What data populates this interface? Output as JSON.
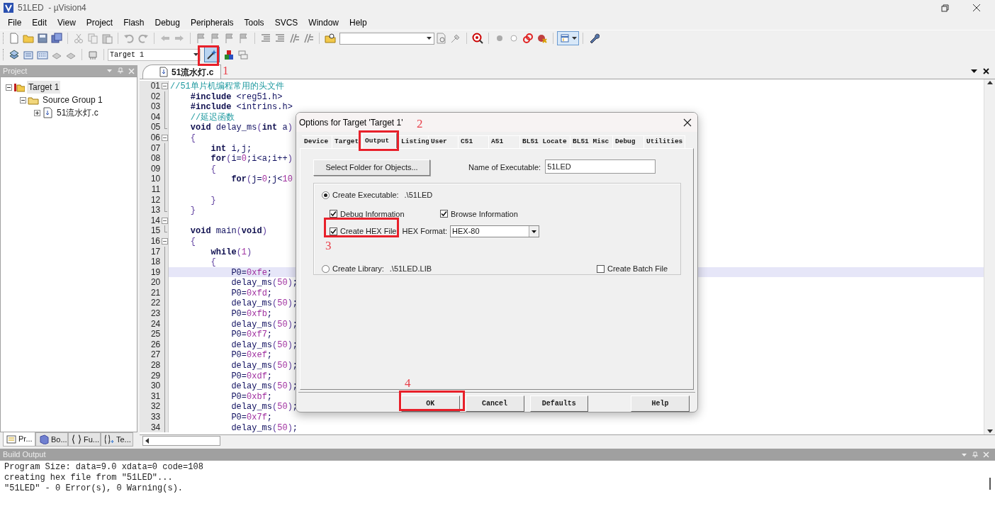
{
  "window": {
    "title": "51LED  - µVision4"
  },
  "menu": [
    "File",
    "Edit",
    "View",
    "Project",
    "Flash",
    "Debug",
    "Peripherals",
    "Tools",
    "SVCS",
    "Window",
    "Help"
  ],
  "build_toolbar": {
    "target": "Target 1"
  },
  "project_panel": {
    "title": "Project",
    "tree": [
      {
        "label": "Target 1",
        "selected": true,
        "expanded": true,
        "children": [
          {
            "label": "Source Group 1",
            "selected": false,
            "expanded": true,
            "children": [
              {
                "label": "51流水灯.c",
                "selected": false,
                "expanded": false
              }
            ]
          }
        ]
      }
    ],
    "tabs": [
      {
        "label": "Pr...",
        "selected": true
      },
      {
        "label": "Bo...",
        "selected": false
      },
      {
        "label": "Fu...",
        "selected": false
      },
      {
        "label": "Te...",
        "selected": false
      }
    ]
  },
  "editor": {
    "tabs": [
      {
        "label": "51流水灯.c",
        "selected": true
      }
    ],
    "lines": [
      {
        "number": "01",
        "kind": "fold_start",
        "current": false,
        "segments": [
          {
            "kind": "comment",
            "text": "//51单片机编程常用的头文件"
          }
        ]
      },
      {
        "number": "02",
        "kind": "fold_body",
        "current": false,
        "segments": [
          {
            "kind": "keyword",
            "text": "    #include"
          },
          {
            "kind": "plain",
            "text": " <reg51.h>"
          }
        ]
      },
      {
        "number": "03",
        "kind": "fold_body",
        "current": false,
        "segments": [
          {
            "kind": "keyword",
            "text": "    #include"
          },
          {
            "kind": "plain",
            "text": " <intrins.h>"
          }
        ]
      },
      {
        "number": "04",
        "kind": "fold_body",
        "current": false,
        "segments": [
          {
            "kind": "comment",
            "text": "    //延迟函数"
          }
        ]
      },
      {
        "number": "05",
        "kind": "fold_end",
        "current": false,
        "segments": [
          {
            "kind": "keyword",
            "text": "    void"
          },
          {
            "kind": "plain",
            "text": " delay_ms"
          },
          {
            "kind": "op",
            "text": "("
          },
          {
            "kind": "keyword",
            "text": "int"
          },
          {
            "kind": "plain",
            "text": " a"
          },
          {
            "kind": "op",
            "text": ")"
          }
        ]
      },
      {
        "number": "06",
        "kind": "fold_start",
        "current": false,
        "segments": [
          {
            "kind": "op",
            "text": "    {"
          }
        ]
      },
      {
        "number": "07",
        "kind": "fold_body",
        "current": false,
        "segments": [
          {
            "kind": "keyword",
            "text": "        int"
          },
          {
            "kind": "plain",
            "text": " i,j;"
          }
        ]
      },
      {
        "number": "08",
        "kind": "fold_body",
        "current": false,
        "segments": [
          {
            "kind": "keyword",
            "text": "        for"
          },
          {
            "kind": "op",
            "text": "("
          },
          {
            "kind": "plain",
            "text": "i="
          },
          {
            "kind": "number",
            "text": "0"
          },
          {
            "kind": "plain",
            "text": ";i<a;i++"
          },
          {
            "kind": "op",
            "text": ")"
          }
        ]
      },
      {
        "number": "09",
        "kind": "fold_body",
        "current": false,
        "segments": [
          {
            "kind": "op",
            "text": "        {"
          }
        ]
      },
      {
        "number": "10",
        "kind": "fold_body",
        "current": false,
        "segments": [
          {
            "kind": "keyword",
            "text": "            for"
          },
          {
            "kind": "op",
            "text": "("
          },
          {
            "kind": "plain",
            "text": "j="
          },
          {
            "kind": "number",
            "text": "0"
          },
          {
            "kind": "plain",
            "text": ";j<"
          },
          {
            "kind": "number",
            "text": "10"
          }
        ]
      },
      {
        "number": "11",
        "kind": "fold_body",
        "current": false
      },
      {
        "number": "12",
        "kind": "fold_body",
        "current": false,
        "segments": [
          {
            "kind": "op",
            "text": "        }"
          }
        ]
      },
      {
        "number": "13",
        "kind": "fold_end",
        "current": false,
        "segments": [
          {
            "kind": "op",
            "text": "    }"
          }
        ]
      },
      {
        "number": "14",
        "kind": "fold_start",
        "current": false
      },
      {
        "number": "15",
        "kind": "fold_end",
        "current": false,
        "segments": [
          {
            "kind": "keyword",
            "text": "    void"
          },
          {
            "kind": "plain",
            "text": " main"
          },
          {
            "kind": "op",
            "text": "("
          },
          {
            "kind": "keyword",
            "text": "void"
          },
          {
            "kind": "op",
            "text": ")"
          }
        ]
      },
      {
        "number": "16",
        "kind": "fold_start",
        "current": false,
        "segments": [
          {
            "kind": "op",
            "text": "    {"
          }
        ]
      },
      {
        "number": "17",
        "kind": "fold_body",
        "current": false,
        "segments": [
          {
            "kind": "keyword",
            "text": "        while"
          },
          {
            "kind": "op",
            "text": "("
          },
          {
            "kind": "number",
            "text": "1"
          },
          {
            "kind": "op",
            "text": ")"
          }
        ]
      },
      {
        "number": "18",
        "kind": "fold_body",
        "current": false,
        "segments": [
          {
            "kind": "op",
            "text": "        {"
          }
        ]
      },
      {
        "number": "19",
        "kind": "fold_body",
        "current": true,
        "segments": [
          {
            "kind": "plain",
            "text": "            P0="
          },
          {
            "kind": "number",
            "text": "0xfe"
          },
          {
            "kind": "plain",
            "text": ";"
          }
        ]
      },
      {
        "number": "20",
        "kind": "fold_body",
        "current": false,
        "segments": [
          {
            "kind": "plain",
            "text": "            delay_ms"
          },
          {
            "kind": "op",
            "text": "("
          },
          {
            "kind": "number",
            "text": "50"
          },
          {
            "kind": "op",
            "text": ")"
          },
          {
            "kind": "plain",
            "text": ";"
          }
        ]
      },
      {
        "number": "21",
        "kind": "fold_body",
        "current": false,
        "segments": [
          {
            "kind": "plain",
            "text": "            P0="
          },
          {
            "kind": "number",
            "text": "0xfd"
          },
          {
            "kind": "plain",
            "text": ";"
          }
        ]
      },
      {
        "number": "22",
        "kind": "fold_body",
        "current": false,
        "segments": [
          {
            "kind": "plain",
            "text": "            delay_ms"
          },
          {
            "kind": "op",
            "text": "("
          },
          {
            "kind": "number",
            "text": "50"
          },
          {
            "kind": "op",
            "text": ")"
          },
          {
            "kind": "plain",
            "text": ";"
          }
        ]
      },
      {
        "number": "23",
        "kind": "fold_body",
        "current": false,
        "segments": [
          {
            "kind": "plain",
            "text": "            P0="
          },
          {
            "kind": "number",
            "text": "0xfb"
          },
          {
            "kind": "plain",
            "text": ";"
          }
        ]
      },
      {
        "number": "24",
        "kind": "fold_body",
        "current": false,
        "segments": [
          {
            "kind": "plain",
            "text": "            delay_ms"
          },
          {
            "kind": "op",
            "text": "("
          },
          {
            "kind": "number",
            "text": "50"
          },
          {
            "kind": "op",
            "text": ")"
          },
          {
            "kind": "plain",
            "text": ";"
          }
        ]
      },
      {
        "number": "25",
        "kind": "fold_body",
        "current": false,
        "segments": [
          {
            "kind": "plain",
            "text": "            P0="
          },
          {
            "kind": "number",
            "text": "0xf7"
          },
          {
            "kind": "plain",
            "text": ";"
          }
        ]
      },
      {
        "number": "26",
        "kind": "fold_body",
        "current": false,
        "segments": [
          {
            "kind": "plain",
            "text": "            delay_ms"
          },
          {
            "kind": "op",
            "text": "("
          },
          {
            "kind": "number",
            "text": "50"
          },
          {
            "kind": "op",
            "text": ")"
          },
          {
            "kind": "plain",
            "text": ";"
          }
        ]
      },
      {
        "number": "27",
        "kind": "fold_body",
        "current": false,
        "segments": [
          {
            "kind": "plain",
            "text": "            P0="
          },
          {
            "kind": "number",
            "text": "0xef"
          },
          {
            "kind": "plain",
            "text": ";"
          }
        ]
      },
      {
        "number": "28",
        "kind": "fold_body",
        "current": false,
        "segments": [
          {
            "kind": "plain",
            "text": "            delay_ms"
          },
          {
            "kind": "op",
            "text": "("
          },
          {
            "kind": "number",
            "text": "50"
          },
          {
            "kind": "op",
            "text": ")"
          },
          {
            "kind": "plain",
            "text": ";"
          }
        ]
      },
      {
        "number": "29",
        "kind": "fold_body",
        "current": false,
        "segments": [
          {
            "kind": "plain",
            "text": "            P0="
          },
          {
            "kind": "number",
            "text": "0xdf"
          },
          {
            "kind": "plain",
            "text": ";"
          }
        ]
      },
      {
        "number": "30",
        "kind": "fold_body",
        "current": false,
        "segments": [
          {
            "kind": "plain",
            "text": "            delay_ms"
          },
          {
            "kind": "op",
            "text": "("
          },
          {
            "kind": "number",
            "text": "50"
          },
          {
            "kind": "op",
            "text": ")"
          },
          {
            "kind": "plain",
            "text": ";"
          }
        ]
      },
      {
        "number": "31",
        "kind": "fold_body",
        "current": false,
        "segments": [
          {
            "kind": "plain",
            "text": "            P0="
          },
          {
            "kind": "number",
            "text": "0xbf"
          },
          {
            "kind": "plain",
            "text": ";"
          }
        ]
      },
      {
        "number": "32",
        "kind": "fold_body",
        "current": false,
        "segments": [
          {
            "kind": "plain",
            "text": "            delay_ms"
          },
          {
            "kind": "op",
            "text": "("
          },
          {
            "kind": "number",
            "text": "50"
          },
          {
            "kind": "op",
            "text": ")"
          },
          {
            "kind": "plain",
            "text": ";"
          }
        ]
      },
      {
        "number": "33",
        "kind": "fold_body",
        "current": false,
        "segments": [
          {
            "kind": "plain",
            "text": "            P0="
          },
          {
            "kind": "number",
            "text": "0x7f"
          },
          {
            "kind": "plain",
            "text": ";"
          }
        ]
      },
      {
        "number": "34",
        "kind": "fold_body",
        "current": false,
        "segments": [
          {
            "kind": "plain",
            "text": "            delay_ms"
          },
          {
            "kind": "op",
            "text": "("
          },
          {
            "kind": "number",
            "text": "50"
          },
          {
            "kind": "op",
            "text": ")"
          },
          {
            "kind": "plain",
            "text": ";"
          }
        ]
      }
    ]
  },
  "build_output": {
    "title": "Build Output",
    "lines": [
      "Program Size: data=9.0 xdata=0 code=108",
      "creating hex file from \"51LED\"...",
      "\"51LED\" - 0 Error(s), 0 Warning(s)."
    ]
  },
  "dialog": {
    "title": "Options for Target 'Target 1'",
    "tabs": [
      {
        "label": "Device",
        "selected": false
      },
      {
        "label": "Target",
        "selected": false
      },
      {
        "label": "Output",
        "selected": true
      },
      {
        "label": "Listing",
        "selected": false
      },
      {
        "label": "User",
        "selected": false
      },
      {
        "label": "C51",
        "selected": false
      },
      {
        "label": "A51",
        "selected": false
      },
      {
        "label": "BL51 Locate",
        "selected": false
      },
      {
        "label": "BL51 Misc",
        "selected": false
      },
      {
        "label": "Debug",
        "selected": false
      },
      {
        "label": "Utilities",
        "selected": false
      }
    ],
    "select_folder_button": "Select Folder for Objects...",
    "executable_name": {
      "label": "Name of Executable:",
      "value": "51LED"
    },
    "create_executable": {
      "label": "Create Executable:",
      "path": ".\\51LED",
      "selected": true
    },
    "debug_information": {
      "label": "Debug Information",
      "checked": true
    },
    "browse_information": {
      "label": "Browse Information",
      "checked": true
    },
    "create_hex_file": {
      "label": "Create HEX File",
      "checked": true
    },
    "hex_format": {
      "label": "HEX Format:",
      "value": "HEX-80"
    },
    "create_library": {
      "label": "Create Library:",
      "path": ".\\51LED.LIB",
      "selected": false
    },
    "create_batch_file": {
      "label": "Create Batch File",
      "checked": false
    },
    "buttons": [
      "OK",
      "Cancel",
      "Defaults",
      "Help"
    ]
  },
  "annotations": [
    {
      "label": "1"
    },
    {
      "label": "2"
    },
    {
      "label": "3"
    },
    {
      "label": "4"
    }
  ]
}
